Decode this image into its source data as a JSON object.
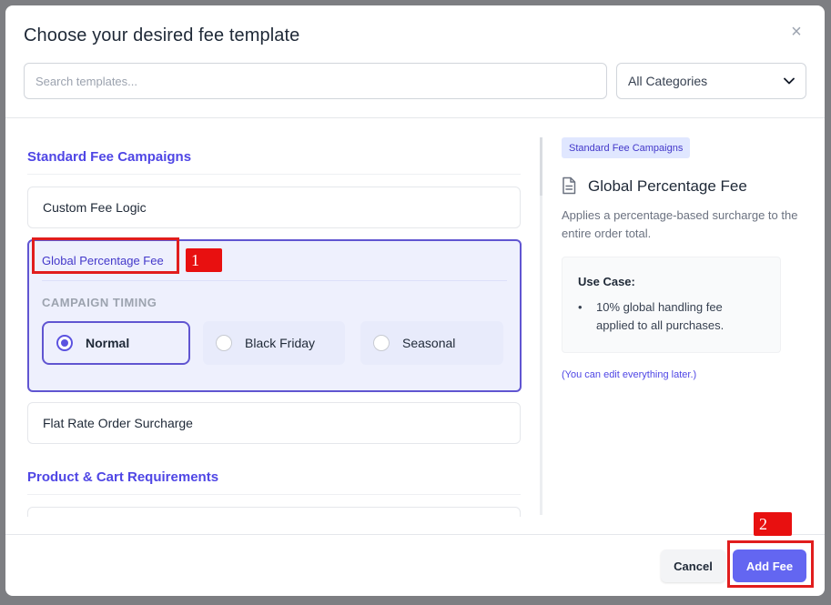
{
  "modal": {
    "title": "Choose your desired fee template",
    "close_glyph": "×"
  },
  "search": {
    "placeholder": "Search templates...",
    "value": ""
  },
  "category_select": {
    "selected": "All Categories"
  },
  "groups": [
    {
      "title": "Standard Fee Campaigns",
      "templates": [
        "Custom Fee Logic",
        "Global Percentage Fee",
        "Flat Rate Order Surcharge"
      ]
    },
    {
      "title": "Product & Cart Requirements",
      "templates": [
        ""
      ]
    }
  ],
  "selected_template": {
    "name": "Global Percentage Fee",
    "timing_label": "CAMPAIGN TIMING",
    "timing_options": [
      "Normal",
      "Black Friday",
      "Seasonal"
    ],
    "timing_selected": "Normal"
  },
  "detail": {
    "category_badge": "Standard Fee Campaigns",
    "icon": "document-icon",
    "title": "Global Percentage Fee",
    "description": "Applies a percentage-based surcharge to the entire order total.",
    "use_case_title": "Use Case:",
    "use_cases": [
      "10% global handling fee applied to all purchases."
    ],
    "edit_note": "(You can edit everything later.)"
  },
  "footer": {
    "cancel_label": "Cancel",
    "add_label": "Add Fee"
  },
  "annotations": {
    "badge_1": "1",
    "badge_2": "2"
  },
  "colors": {
    "accent": "#6366f1",
    "group_title": "#4f46e5",
    "annotation_red": "#e11d1d",
    "overlay": "#7d7e82"
  }
}
